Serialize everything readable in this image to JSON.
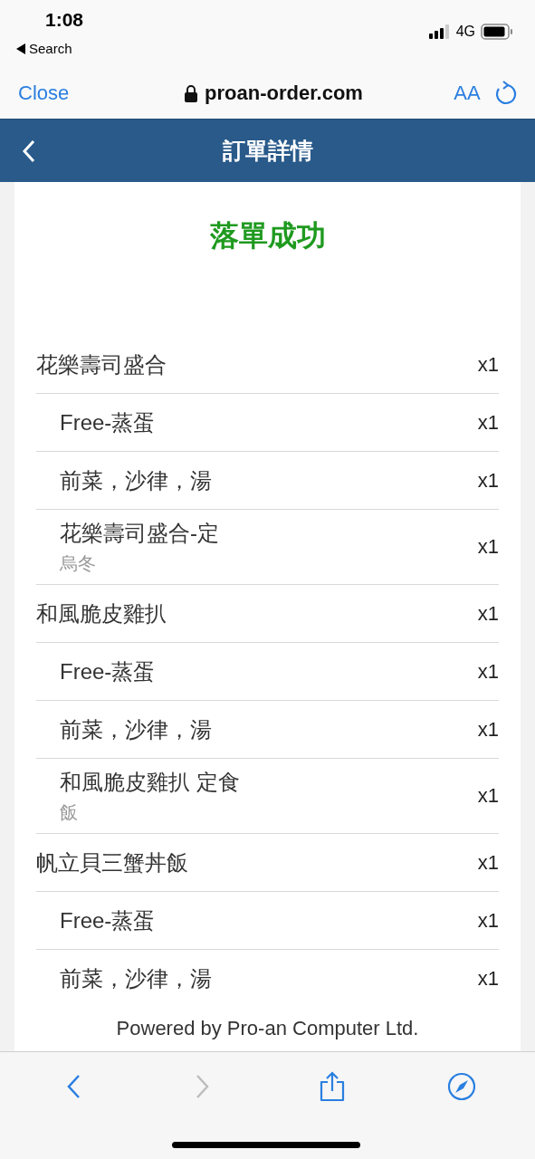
{
  "status_bar": {
    "time": "1:08",
    "back_label": "Search",
    "network": "4G"
  },
  "browser": {
    "close": "Close",
    "url": "proan-order.com",
    "text_size": "AA"
  },
  "header": {
    "title": "訂單詳情"
  },
  "order": {
    "status": "落單成功",
    "items": [
      {
        "name": "花樂壽司盛合",
        "qty": "x1",
        "children": [
          {
            "name": "Free-蒸蛋",
            "qty": "x1"
          },
          {
            "name": "前菜，沙律，湯",
            "qty": "x1"
          },
          {
            "name": "花樂壽司盛合-定",
            "note": "烏冬",
            "qty": "x1"
          }
        ]
      },
      {
        "name": "和風脆皮雞扒",
        "qty": "x1",
        "children": [
          {
            "name": "Free-蒸蛋",
            "qty": "x1"
          },
          {
            "name": "前菜，沙律，湯",
            "qty": "x1"
          },
          {
            "name": "和風脆皮雞扒 定食",
            "note": "飯",
            "qty": "x1"
          }
        ]
      },
      {
        "name": "帆立貝三蟹丼飯",
        "qty": "x1",
        "children": [
          {
            "name": "Free-蒸蛋",
            "qty": "x1"
          },
          {
            "name": "前菜，沙律，湯",
            "qty": "x1"
          }
        ]
      }
    ],
    "footer": "Powered by Pro-an Computer Ltd."
  },
  "toolbar": [
    {
      "kind": "back",
      "disabled": false
    },
    {
      "kind": "forward",
      "disabled": true
    },
    {
      "kind": "share",
      "disabled": false
    },
    {
      "kind": "compass",
      "disabled": false
    }
  ]
}
